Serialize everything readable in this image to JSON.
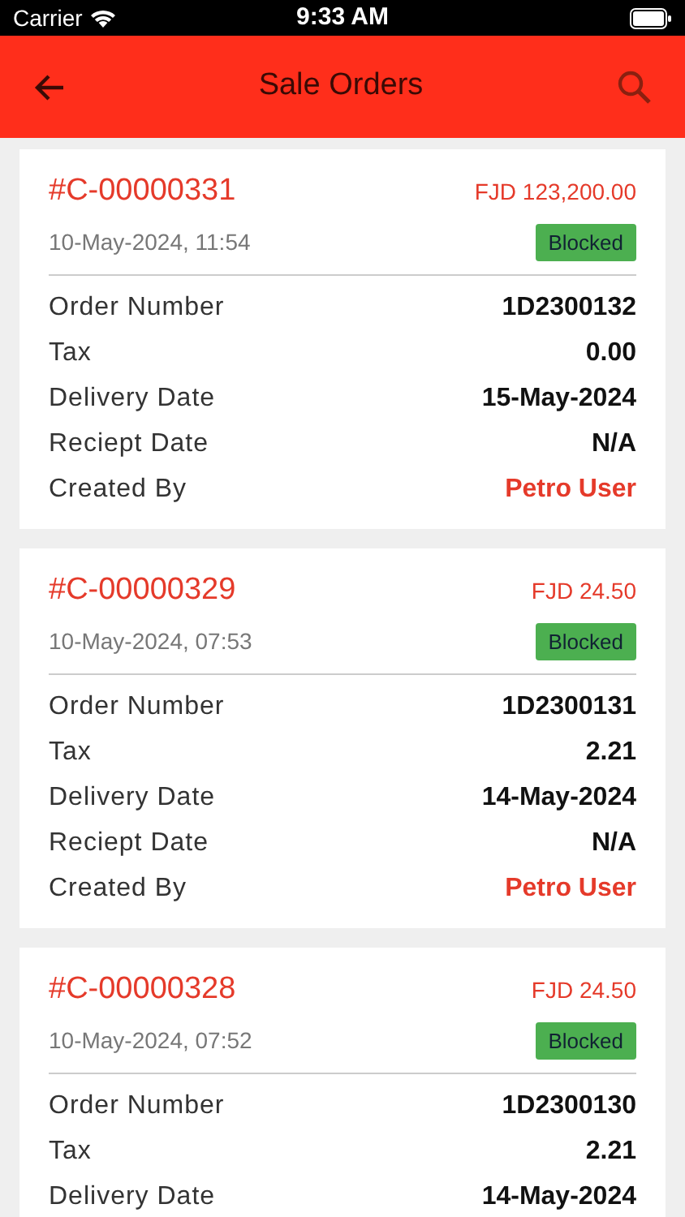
{
  "status_bar": {
    "carrier": "Carrier",
    "time": "9:33 AM"
  },
  "header": {
    "title": "Sale Orders"
  },
  "orders": [
    {
      "number": "#C-00000331",
      "amount": "FJD 123,200.00",
      "date": "10-May-2024, 11:54",
      "status": "Blocked",
      "fields": [
        {
          "label": "Order Number",
          "value": "1D2300132",
          "kind": "plain"
        },
        {
          "label": "Tax",
          "value": "0.00",
          "kind": "plain"
        },
        {
          "label": "Delivery Date",
          "value": "15-May-2024",
          "kind": "plain"
        },
        {
          "label": "Reciept Date",
          "value": "N/A",
          "kind": "plain"
        },
        {
          "label": "Created By",
          "value": "Petro User",
          "kind": "accent"
        }
      ]
    },
    {
      "number": "#C-00000329",
      "amount": "FJD 24.50",
      "date": "10-May-2024, 07:53",
      "status": "Blocked",
      "fields": [
        {
          "label": "Order Number",
          "value": "1D2300131",
          "kind": "plain"
        },
        {
          "label": "Tax",
          "value": "2.21",
          "kind": "plain"
        },
        {
          "label": "Delivery Date",
          "value": "14-May-2024",
          "kind": "plain"
        },
        {
          "label": "Reciept Date",
          "value": "N/A",
          "kind": "plain"
        },
        {
          "label": "Created By",
          "value": "Petro User",
          "kind": "accent"
        }
      ]
    },
    {
      "number": "#C-00000328",
      "amount": "FJD 24.50",
      "date": "10-May-2024, 07:52",
      "status": "Blocked",
      "fields": [
        {
          "label": "Order Number",
          "value": "1D2300130",
          "kind": "plain"
        },
        {
          "label": "Tax",
          "value": "2.21",
          "kind": "plain"
        },
        {
          "label": "Delivery Date",
          "value": "14-May-2024",
          "kind": "plain"
        }
      ]
    }
  ]
}
